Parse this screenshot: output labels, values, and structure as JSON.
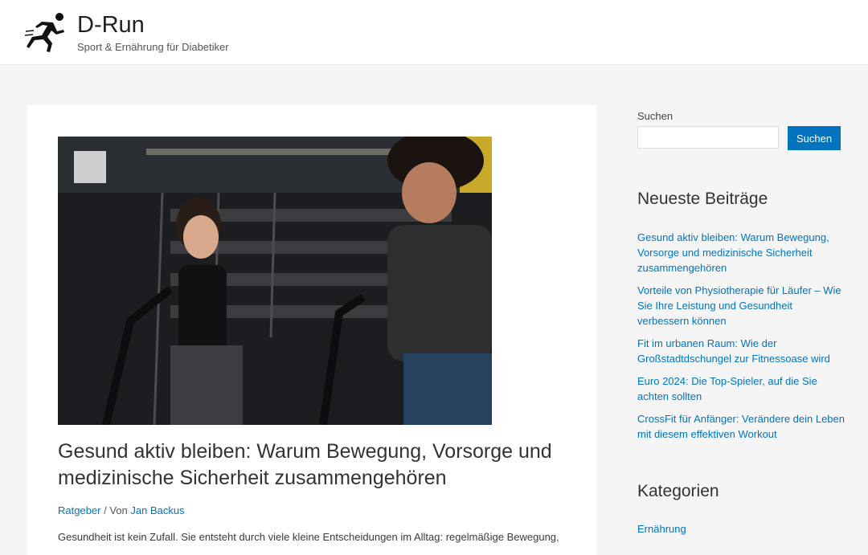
{
  "header": {
    "site_title": "D-Run",
    "tagline": "Sport & Ernährung für Diabetiker",
    "logo_icon": "runner-icon"
  },
  "article": {
    "image_icon": "gym-bikes-photo",
    "title": "Gesund aktiv bleiben: Warum Bewegung, Vorsorge und medizinische Sicherheit zusammengehören",
    "category": "Ratgeber",
    "meta_separator": " / Von ",
    "author": "Jan Backus",
    "excerpt": "Gesundheit ist kein Zufall. Sie entsteht durch viele kleine Entscheidungen im Alltag: regelmäßige Bewegung,"
  },
  "sidebar": {
    "search_label": "Suchen",
    "search_value": "",
    "search_button": "Suchen",
    "recent_title": "Neueste Beiträge",
    "recent_posts": [
      "Gesund aktiv bleiben: Warum Bewegung, Vorsorge und medizinische Sicherheit zusammengehören",
      "Vorteile von Physiotherapie für Läufer – Wie Sie Ihre Leistung und Gesundheit verbessern können",
      "Fit im urbanen Raum: Wie der Großstadtdschungel zur Fitnessoase wird",
      "Euro 2024: Die Top-Spieler, auf die Sie achten sollten",
      "CrossFit für Anfänger: Verändere dein Leben mit diesem effektiven Workout"
    ],
    "categories_title": "Kategorien",
    "categories": [
      "Ernährung"
    ]
  },
  "colors": {
    "accent": "#0274be",
    "background": "#f5f5f5"
  }
}
